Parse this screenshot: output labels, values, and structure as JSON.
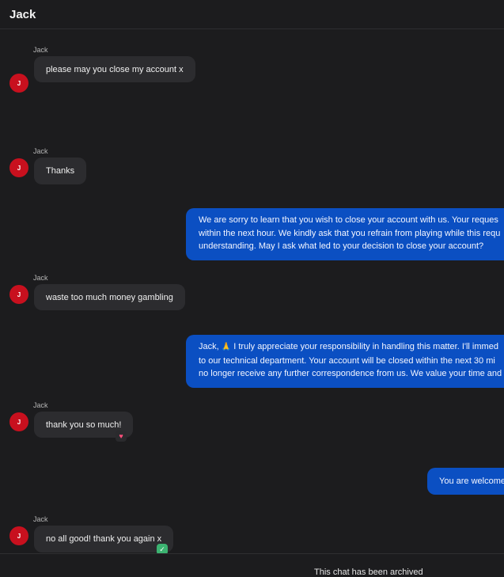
{
  "header": {
    "title": "Jack"
  },
  "messages": [
    {
      "sender": "Jack",
      "avatar_initial": "J",
      "text": "please may you close my account x"
    },
    {
      "sender": "Jack",
      "avatar_initial": "J",
      "text": "Thanks"
    },
    {
      "lines": [
        "We are sorry to learn that you wish to close your account with us. Your reques",
        "within the next hour. We kindly ask that you refrain from playing while this requ",
        "understanding. May I ask what led to your decision to close your account?"
      ]
    },
    {
      "sender": "Jack",
      "avatar_initial": "J",
      "text": "waste too much money gambling"
    },
    {
      "line1_before": "Jack, ",
      "line1_after": " I truly appreciate your responsibility in handling this matter. I'll immed",
      "line2": "to our technical department. Your account will be closed within the next 30 mi",
      "line3": "no longer receive any further correspondence from us. We value your time and"
    },
    {
      "sender": "Jack",
      "avatar_initial": "J",
      "text": "thank you so much!",
      "reaction": "♥"
    },
    {
      "text": "You are welcome"
    },
    {
      "sender": "Jack",
      "avatar_initial": "J",
      "text": "no all good! thank you again x",
      "reaction": "✓"
    }
  ],
  "icons": {
    "praying_hands": "🙏"
  },
  "footer": {
    "archived_text": "This chat has been archived"
  },
  "colors": {
    "background": "#1c1c1e",
    "incoming_bubble": "#2c2c2f",
    "outgoing_bubble": "#0b4fc2",
    "avatar": "#c8101e",
    "heart": "#ff4f7b",
    "check": "#3cb371"
  }
}
